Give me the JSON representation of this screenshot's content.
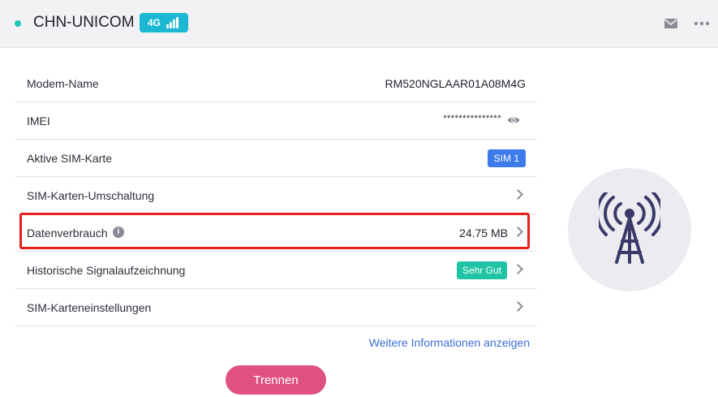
{
  "header": {
    "carrier": "CHN-UNICOM",
    "network_type": "4G",
    "icons": [
      "status-dot",
      "signal-bars-icon",
      "mail-icon",
      "more-icon"
    ]
  },
  "rows": [
    {
      "label": "Modem-Name",
      "value": "RM520NGLAAR01A08M4G"
    },
    {
      "label": "IMEI",
      "value": "***************",
      "icon": "eye-icon"
    },
    {
      "label": "Aktive SIM-Karte",
      "value": "SIM 1"
    },
    {
      "label": "SIM-Karten-Umschaltung",
      "icon": "chevron-right-icon"
    },
    {
      "label": "Datenverbrauch",
      "value": "24.75 MB",
      "icon": "info-icon"
    },
    {
      "label": "Historische Signalaufzeichnung",
      "value": "Sehr Gut",
      "icon": "chevron-right-icon"
    },
    {
      "label": "SIM-Karteneinstellungen",
      "icon": "chevron-right-icon"
    }
  ],
  "more_link": "Weitere Informationen anzeigen",
  "disconnect_label": "Trennen",
  "colors": {
    "accent_teal": "#1bb8d4",
    "sim_badge": "#3e7bea",
    "quality_badge": "#1fc4a5",
    "button": "#e05281",
    "highlight": "#e8201d",
    "link": "#3f6fd6",
    "tower": "#3a3a6a"
  },
  "illustration_icon": "cell-tower-icon"
}
